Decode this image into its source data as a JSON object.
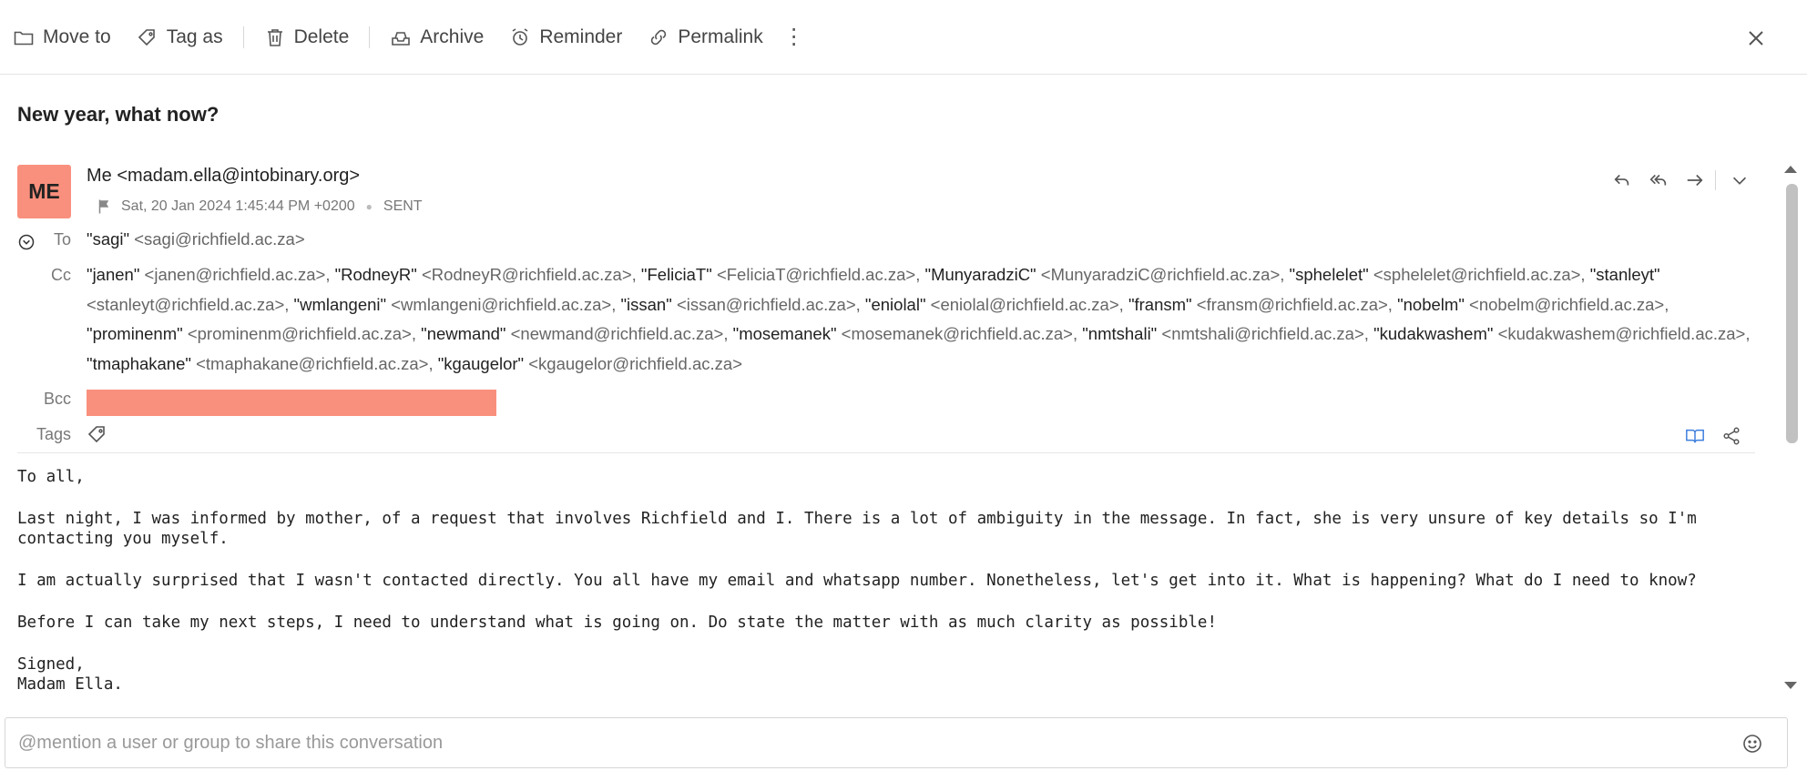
{
  "toolbar": {
    "move_to": "Move to",
    "tag_as": "Tag as",
    "delete": "Delete",
    "archive": "Archive",
    "reminder": "Reminder",
    "permalink": "Permalink",
    "more": "⋮"
  },
  "message": {
    "subject": "New year, what now?",
    "avatar_initials": "ME",
    "from": "Me <madam.ella@intobinary.org>",
    "date": "Sat, 20 Jan 2024 1:45:44 PM +0200",
    "status": "SENT",
    "labels": {
      "to": "To",
      "cc": "Cc",
      "bcc": "Bcc",
      "tags": "Tags"
    },
    "to": [
      {
        "name": "\"sagi\"",
        "email": "<sagi@richfield.ac.za>"
      }
    ],
    "cc": [
      {
        "name": "\"janen\"",
        "email": "<janen@richfield.ac.za>"
      },
      {
        "name": "\"RodneyR\"",
        "email": "<RodneyR@richfield.ac.za>"
      },
      {
        "name": "\"FeliciaT\"",
        "email": "<FeliciaT@richfield.ac.za>"
      },
      {
        "name": "\"MunyaradziC\"",
        "email": "<MunyaradziC@richfield.ac.za>"
      },
      {
        "name": "\"sphelelet\"",
        "email": "<sphelelet@richfield.ac.za>"
      },
      {
        "name": "\"stanleyt\"",
        "email": "<stanleyt@richfield.ac.za>"
      },
      {
        "name": "\"wmlangeni\"",
        "email": "<wmlangeni@richfield.ac.za>"
      },
      {
        "name": "\"issan\"",
        "email": "<issan@richfield.ac.za>"
      },
      {
        "name": "\"eniolal\"",
        "email": "<eniolal@richfield.ac.za>"
      },
      {
        "name": "\"fransm\"",
        "email": "<fransm@richfield.ac.za>"
      },
      {
        "name": "\"nobelm\"",
        "email": "<nobelm@richfield.ac.za>"
      },
      {
        "name": "\"prominenm\"",
        "email": "<prominenm@richfield.ac.za>"
      },
      {
        "name": "\"newmand\"",
        "email": "<newmand@richfield.ac.za>"
      },
      {
        "name": "\"mosemanek\"",
        "email": "<mosemanek@richfield.ac.za>"
      },
      {
        "name": "\"nmtshali\"",
        "email": "<nmtshali@richfield.ac.za>"
      },
      {
        "name": "\"kudakwashem\"",
        "email": "<kudakwashem@richfield.ac.za>"
      },
      {
        "name": "\"tmaphakane\"",
        "email": "<tmaphakane@richfield.ac.za>"
      },
      {
        "name": "\"kgaugelor\"",
        "email": "<kgaugelor@richfield.ac.za>"
      }
    ],
    "body": [
      "To all,",
      "Last night, I was informed by mother, of a request that involves Richfield and I. There is a lot of ambiguity in the message. In fact, she is very unsure of key details so I'm contacting you myself.",
      "I am actually surprised that I wasn't contacted directly. You all have my email and whatsapp number. Nonetheless, let's get into it. What is happening? What do I need to know?",
      "Before I can take my next steps, I need to understand what is going on. Do state the matter with as much clarity as possible!",
      "Signed,\nMadam Ella."
    ]
  },
  "mention": {
    "placeholder": "@mention a user or group to share this conversation"
  },
  "colors": {
    "avatar": "#f9907d",
    "redaction": "#f9907d",
    "read_icon": "#3b7ddd"
  }
}
